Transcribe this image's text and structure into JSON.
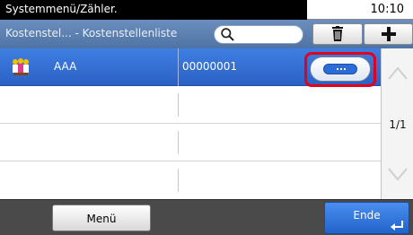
{
  "status": {
    "title": "Systemmenü/Zähler.",
    "time": "10:10"
  },
  "header": {
    "breadcrumb": "Kostenstel... - Kostenstellenliste",
    "search_icon": "search-icon",
    "delete_icon": "trash-icon",
    "add_icon": "plus-icon"
  },
  "list": {
    "rows": [
      {
        "name": "AAA",
        "number": "00000001",
        "selected": true
      },
      {
        "name": "",
        "number": ""
      },
      {
        "name": "",
        "number": ""
      },
      {
        "name": "",
        "number": ""
      }
    ]
  },
  "pager": {
    "indicator": "1/1"
  },
  "footer": {
    "menu_label": "Menü",
    "end_label": "Ende"
  },
  "colors": {
    "selection": "#2f6bd0",
    "highlight": "#e2001a",
    "header": "#5b80b2"
  }
}
